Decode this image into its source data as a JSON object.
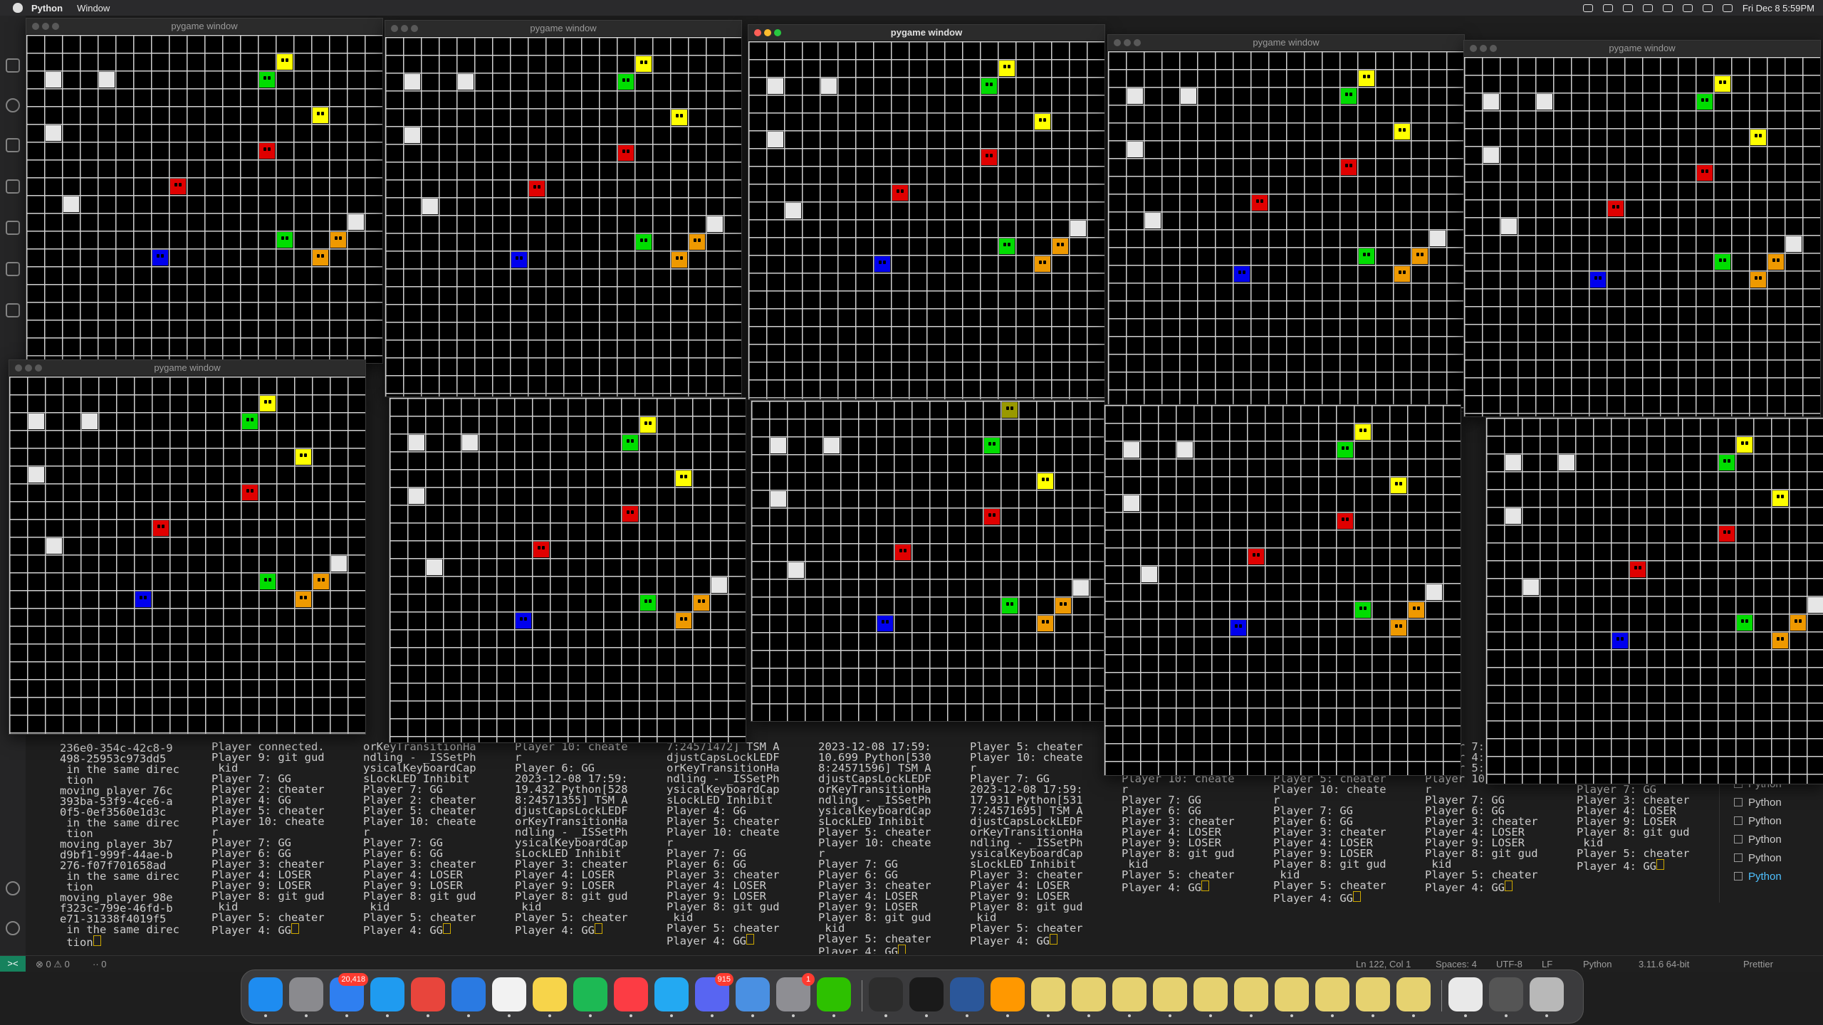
{
  "menubar": {
    "app_name": "Python",
    "menus": [
      "Window"
    ],
    "clock": "Fri Dec 8  5:59PM"
  },
  "window_title": "pygame window",
  "terminal": {
    "columns": [
      "236e0-354c-42c8-9\n498-25953c973dd5\n in the same direc\n tion\nmoving player 76c\n393ba-53f9-4ce6-a\n0f5-0ef3560e1d3c\n in the same direc\n tion\nmoving player 3b7\nd9bf1-999f-44ae-b\n276-f07f701658ad\n in the same direc\n tion\nmoving player 98e\nf323c-799e-46fd-b\ne71-31338f4019f5\n in the same direc\n tion",
      "Player connected.\nPlayer 9: git gud\n kid\nPlayer 7: GG\nPlayer 2: cheater\nPlayer 4: GG\nPlayer 5: cheater\nPlayer 10: cheate\nr\nPlayer 7: GG\nPlayer 6: GG\nPlayer 3: cheater\nPlayer 4: LOSER\nPlayer 9: LOSER\nPlayer 8: git gud\n kid\nPlayer 5: cheater\nPlayer 4: GG",
      "orKeyTransitionHa\nndling - _ISSetPh\nysicalKeyboardCap\nsLockLED Inhibit\nPlayer 7: GG\nPlayer 2: cheater\nPlayer 5: cheater\nPlayer 10: cheate\nr\nPlayer 7: GG\nPlayer 6: GG\nPlayer 3: cheater\nPlayer 4: LOSER\nPlayer 9: LOSER\nPlayer 8: git gud\n kid\nPlayer 5: cheater\nPlayer 4: GG",
      "Player 10: cheate\nr\nPlayer 6: GG\n2023-12-08 17:59:\n19.432 Python[528\n8:24571355] TSM A\ndjustCapsLockLEDF\norKeyTransitionHa\nndling - _ISSetPh\nysicalKeyboardCap\nsLockLED Inhibit\nPlayer 3: cheater\nPlayer 4: LOSER\nPlayer 9: LOSER\nPlayer 8: git gud\n kid\nPlayer 5: cheater\nPlayer 4: GG",
      "7:24571472] TSM A\ndjustCapsLockLEDF\norKeyTransitionHa\nndling - _ISSetPh\nysicalKeyboardCap\nsLockLED Inhibit\nPlayer 4: GG\nPlayer 5: cheater\nPlayer 10: cheate\nr\nPlayer 7: GG\nPlayer 6: GG\nPlayer 3: cheater\nPlayer 4: LOSER\nPlayer 9: LOSER\nPlayer 8: git gud\n kid\nPlayer 5: cheater\nPlayer 4: GG",
      "2023-12-08 17:59:\n10.699 Python[530\n8:24571596] TSM A\ndjustCapsLockLEDF\norKeyTransitionHa\nndling - _ISSetPh\nysicalKeyboardCap\nsLockLED Inhibit\nPlayer 5: cheater\nPlayer 10: cheate\nr\nPlayer 7: GG\nPlayer 6: GG\nPlayer 3: cheater\nPlayer 4: LOSER\nPlayer 9: LOSER\nPlayer 8: git gud\n kid\nPlayer 5: cheater\nPlayer 4: GG",
      "Player 5: cheater\nPlayer 10: cheate\nr\nPlayer 7: GG\n2023-12-08 17:59:\n17.931 Python[531\n7:24571695] TSM A\ndjustCapsLockLEDF\norKeyTransitionHa\nndling - _ISSetPh\nysicalKeyboardCap\nsLockLED Inhibit\nPlayer 3: cheater\nPlayer 4: LOSER\nPlayer 9: LOSER\nPlayer 8: git gud\n kid\nPlayer 5: cheater\nPlayer 4: GG",
      "Player 7: GG\nPlayer 4: GG\nPlayer 5: cheater\nPlayer 10: cheate\nr\nPlayer 7: GG\nPlayer 6: GG\nPlayer 3: cheater\nPlayer 4: LOSER\nPlayer 9: LOSER\nPlayer 8: git gud\n kid\nPlayer 5: cheater\nPlayer 4: GG",
      "Player 7: GG\nPlayer 2: cheater\nPlayer 4: GG\nPlayer 5: cheater\nPlayer 10: cheate\nr\nPlayer 7: GG\nPlayer 6: GG\nPlayer 3: cheater\nPlayer 4: LOSER\nPlayer 9: LOSER\nPlayer 8: git gud\n kid\nPlayer 5: cheater\nPlayer 4: GG",
      "Player 7: GG\nPlayer 4: GG\nPlayer 5: cheater\nPlayer 10: cheate\nr\nPlayer 7: GG\nPlayer 6: GG\nPlayer 3: cheater\nPlayer 4: LOSER\nPlayer 9: LOSER\nPlayer 8: git gud\n kid\nPlayer 5: cheater\nPlayer 4: GG",
      "orKeyTransitionHa\nndling - _ISSetPh\nysicalKeyboardCap\nsLockLED Inhibit\nPlayer 7: GG\nPlayer 3: cheater\nPlayer 4: LOSER\nPlayer 9: LOSER\nPlayer 8: git gud\n kid\nPlayer 5: cheater\nPlayer 4: GG"
    ],
    "list_items": [
      "Python",
      "Python",
      "Python",
      "Python",
      "Python",
      "Python"
    ]
  },
  "statusbar": {
    "problems": "⊗ 0 ⚠ 0",
    "ports": "·· 0",
    "position": "Ln 122, Col 1",
    "spaces": "Spaces: 4",
    "encoding": "UTF-8",
    "eol": "LF",
    "language": "Python",
    "interpreter": "3.11.6 64-bit",
    "formatter": "Prettier"
  },
  "game": {
    "board_colors": {
      "grid": "#d0d0d0",
      "background": "#000000"
    },
    "piece_colors": {
      "white": "#e6e6e6",
      "green": "#00dd00",
      "yellow": "#ffff00",
      "red": "#e00000",
      "blue": "#0000ee",
      "orange": "#ee9900",
      "olive": "#999900"
    },
    "pieces": [
      {
        "color": "white",
        "face": false,
        "col": 1,
        "row": 2
      },
      {
        "color": "white",
        "face": false,
        "col": 4,
        "row": 2
      },
      {
        "color": "white",
        "face": false,
        "col": 1,
        "row": 5
      },
      {
        "color": "white",
        "face": false,
        "col": 2,
        "row": 9
      },
      {
        "color": "white",
        "face": false,
        "col": 18,
        "row": 10
      },
      {
        "color": "yellow",
        "face": true,
        "col": 14,
        "row": 1
      },
      {
        "color": "green",
        "face": true,
        "col": 13,
        "row": 2
      },
      {
        "color": "yellow",
        "face": true,
        "col": 16,
        "row": 4
      },
      {
        "color": "red",
        "face": true,
        "col": 13,
        "row": 6
      },
      {
        "color": "red",
        "face": true,
        "col": 8,
        "row": 8
      },
      {
        "color": "green",
        "face": true,
        "col": 14,
        "row": 11
      },
      {
        "color": "orange",
        "face": true,
        "col": 17,
        "row": 11
      },
      {
        "color": "orange",
        "face": true,
        "col": 16,
        "row": 12
      },
      {
        "color": "blue",
        "face": true,
        "col": 7,
        "row": 12
      }
    ]
  },
  "dock": {
    "badges": {
      "mail": "20,418",
      "discord": "915",
      "settings": "1"
    }
  }
}
